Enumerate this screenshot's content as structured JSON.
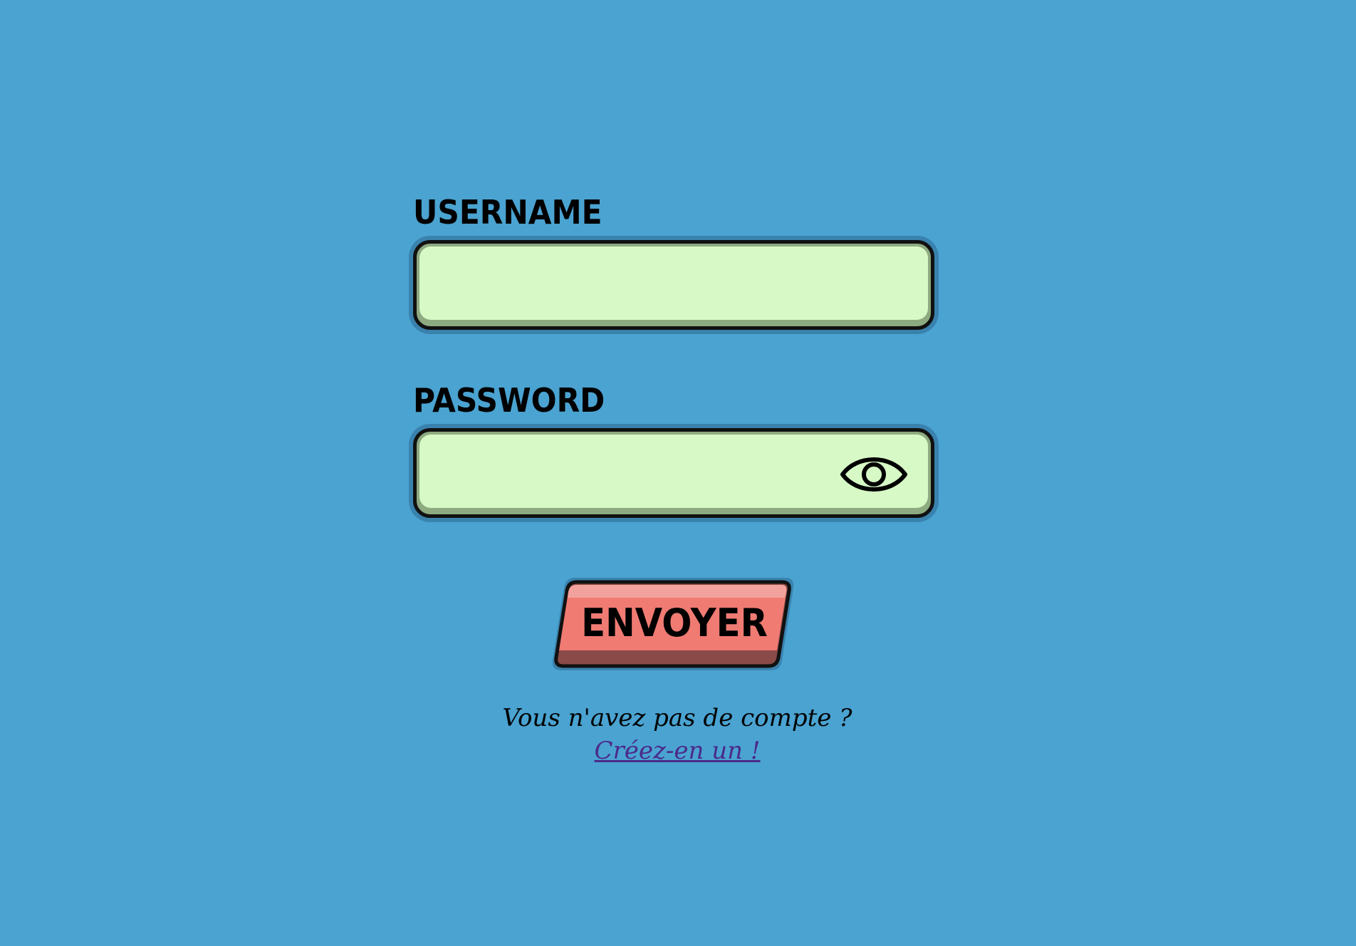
{
  "form": {
    "username_label": "USERNAME",
    "username_value": "",
    "password_label": "PASSWORD",
    "password_value": "",
    "password_toggle_icon": "eye-icon",
    "submit_label": "ENVOYER"
  },
  "signup": {
    "prompt": "Vous n'avez pas de compte ?",
    "link_label": "Créez-en un !"
  },
  "colors": {
    "background": "#4aa3d1",
    "input_fill": "#d6f9c6",
    "button_fill": "#f07b73",
    "link": "#4b2a8a"
  }
}
